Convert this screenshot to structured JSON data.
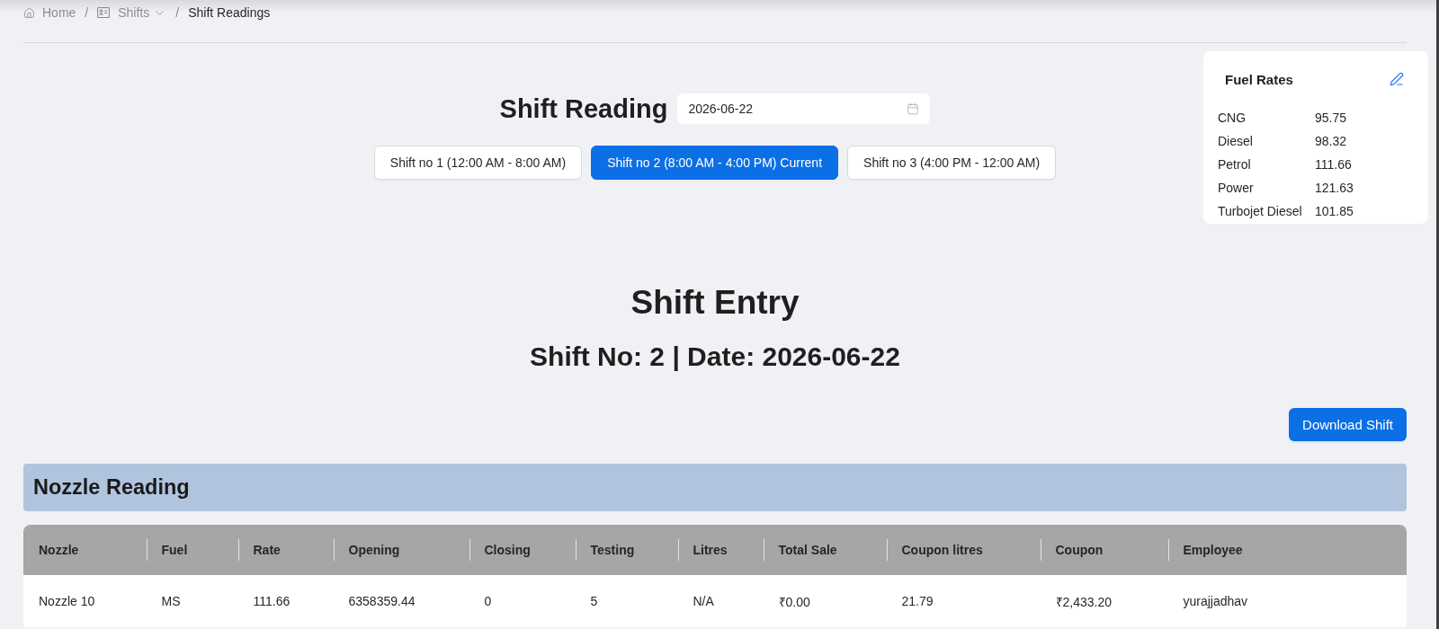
{
  "breadcrumb": [
    {
      "kind": "home",
      "label": "Home",
      "current": false
    },
    {
      "kind": "menu",
      "label": "Shifts",
      "separator": "/",
      "current": false
    },
    {
      "kind": "page",
      "label": "Shift Readings",
      "separator": "/",
      "current": true
    }
  ],
  "shift_reading": {
    "title": "Shift Reading",
    "date": "2026-06-22"
  },
  "shifts": [
    {
      "label": "Shift no 1 (12:00 AM - 8:00 AM)",
      "selected": false
    },
    {
      "label": "Shift no 2 (8:00 AM - 4:00 PM) Current",
      "selected": true
    },
    {
      "label": "Shift no 3 (4:00 PM - 12:00 AM)",
      "selected": false
    }
  ],
  "fuel_rates": {
    "title": "Fuel Rates",
    "rates": [
      {
        "fuel": "CNG",
        "rate": "95.75"
      },
      {
        "fuel": "Diesel",
        "rate": "98.32"
      },
      {
        "fuel": "Petrol",
        "rate": "111.66"
      },
      {
        "fuel": "Power",
        "rate": "121.63"
      },
      {
        "fuel": "Turbojet Diesel",
        "rate": "101.85"
      }
    ]
  },
  "shift_entry": {
    "title": "Shift Entry",
    "subtitle": "Shift No: 2 | Date: 2026-06-22",
    "download_button": "Download Shift"
  },
  "nozzle_reading": {
    "title": "Nozzle Reading",
    "table": {
      "columns": [
        "Nozzle",
        "Fuel",
        "Rate",
        "Opening",
        "Closing",
        "Testing",
        "Litres",
        "Total Sale",
        "Coupon litres",
        "Coupon",
        "Employee"
      ],
      "rows": [
        [
          "Nozzle 10",
          "MS",
          "111.66",
          "6358359.44",
          "0",
          "5",
          "N/A",
          "₹0.00",
          "21.79",
          "₹2,433.20",
          "yurajjadhav"
        ]
      ]
    }
  }
}
